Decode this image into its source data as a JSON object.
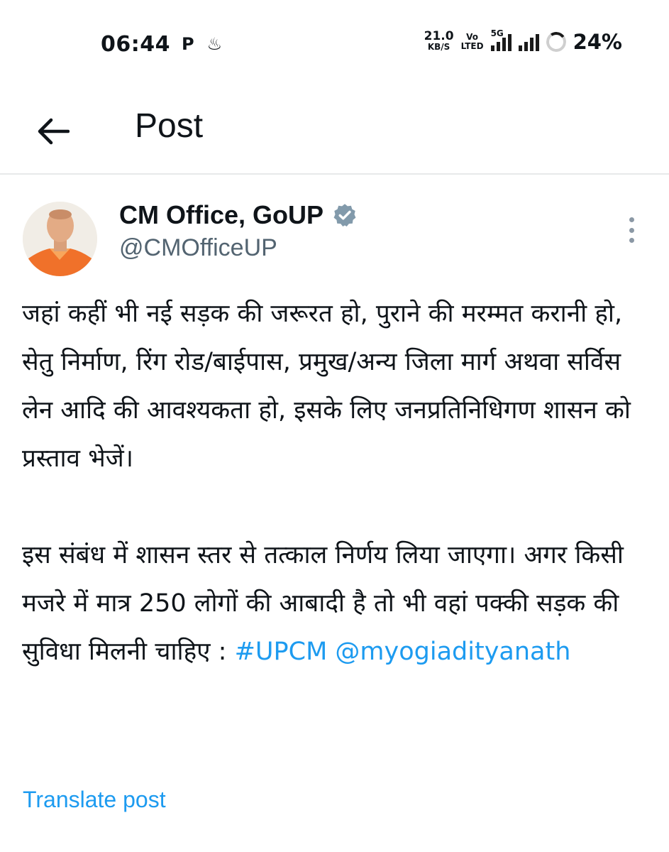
{
  "status_bar": {
    "time": "06:44",
    "left_icons": [
      "P",
      "♨"
    ],
    "net_speed_value": "21.0",
    "net_speed_unit": "KB/S",
    "volte_top": "Vo",
    "volte_bottom": "LTED",
    "network_type": "5G",
    "battery_percent": "24%"
  },
  "header": {
    "back_icon": "arrow-left-icon",
    "title": "Post"
  },
  "post": {
    "author_name": "CM Office, GoUP",
    "author_handle": "@CMOfficeUP",
    "verified_color": "#829aab",
    "paragraph_1": "जहां कहीं भी नई सड़क की जरूरत हो, पुराने की मरम्मत करानी हो, सेतु निर्माण, रिंग रोड/बाईपास, प्रमुख/अन्य जिला मार्ग अथवा सर्विस लेन आदि की आवश्यकता हो, इसके लिए जनप्रतिनिधिगण शासन को प्रस्ताव भेजें।",
    "paragraph_2_text": "इस संबंध में शासन स्तर से तत्काल निर्णय लिया जाएगा। अगर किसी मजरे में मात्र 250 लोगों की आबादी है तो भी वहां पक्की सड़क की सुविधा मिलनी चाहिए : ",
    "hashtag": "#UPCM",
    "mention": "@myogiadityanath",
    "translate_label": "Translate post"
  },
  "colors": {
    "link": "#1d9bf0",
    "secondary_text": "#536471",
    "divider": "#e7e9ea"
  }
}
